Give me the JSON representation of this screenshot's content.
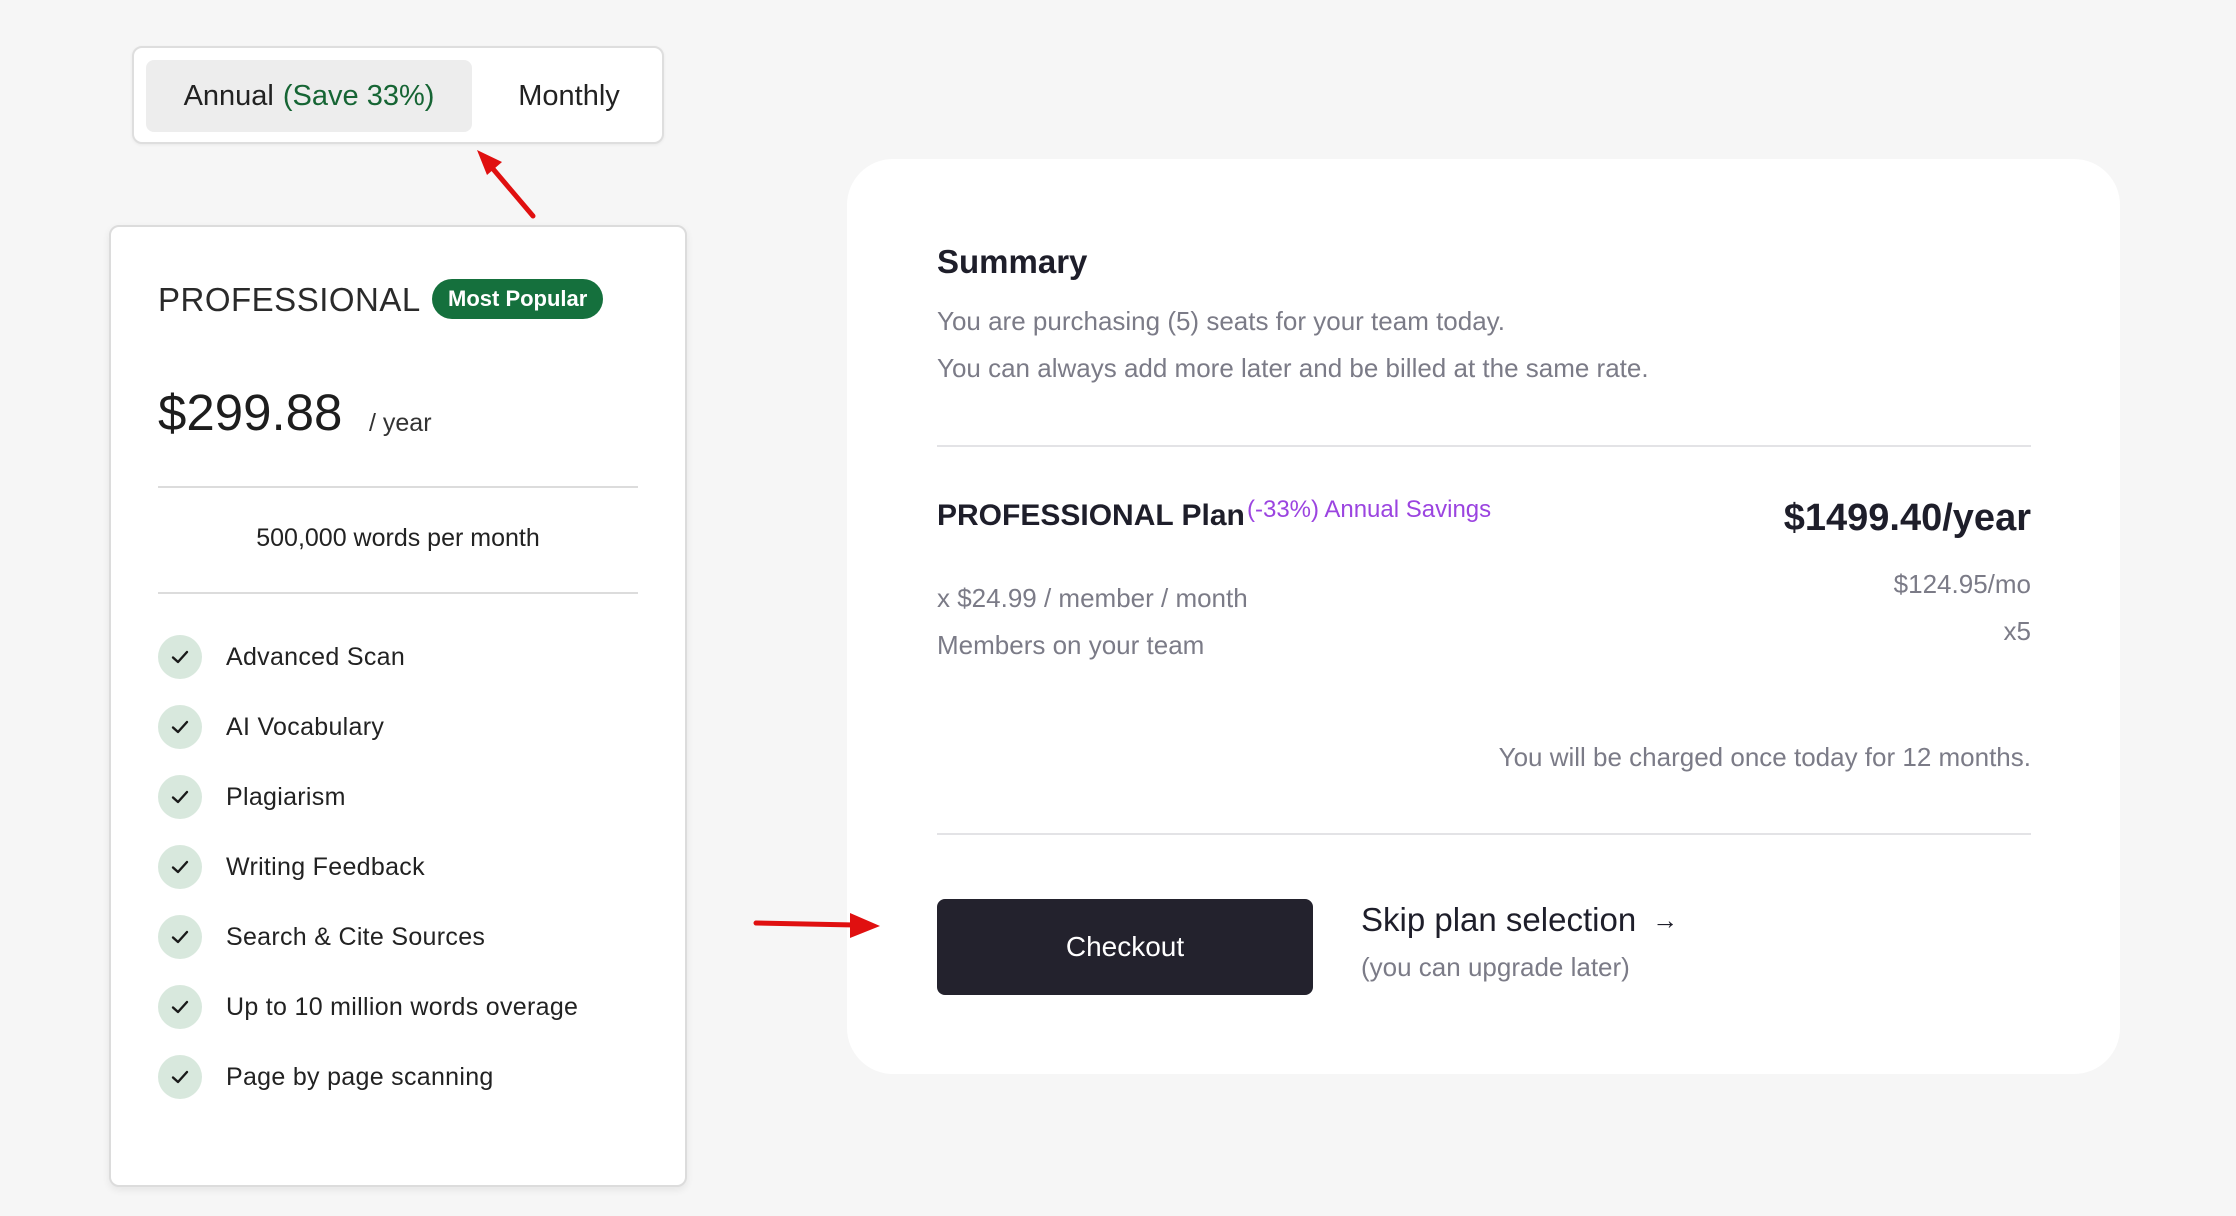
{
  "billing_toggle": {
    "annual_label": "Annual",
    "annual_savings": "(Save 33%)",
    "monthly_label": "Monthly",
    "selected": "Annual"
  },
  "plan_card": {
    "name": "PROFESSIONAL",
    "badge": "Most Popular",
    "price": "$299.88",
    "period": "/ year",
    "quota": "500,000 words per month",
    "features": [
      "Advanced Scan",
      "AI Vocabulary",
      "Plagiarism",
      "Writing Feedback",
      "Search & Cite Sources",
      "Up to 10 million words overage",
      "Page by page scanning"
    ]
  },
  "summary": {
    "title": "Summary",
    "line1": "You are purchasing (5) seats for your team today.",
    "line2": "You can always add more later and be billed at the same rate.",
    "plan_title": "PROFESSIONAL Plan",
    "savings": "(-33%) Annual Savings",
    "total": "$1499.40/year",
    "per_member": "x $24.99 / member / month",
    "monthly_total": "$124.95/mo",
    "members_label": "Members on your team",
    "members_count": "x5",
    "charge_note": "You will be charged once today for 12 months.",
    "checkout_label": "Checkout",
    "skip_label": "Skip plan selection",
    "skip_sub": "(you can upgrade later)"
  },
  "colors": {
    "badge": "#15703d",
    "save": "#166534",
    "savings_purple": "#9b44e0",
    "checkout_bg": "#23222d",
    "annotation_arrow": "#e01010"
  }
}
